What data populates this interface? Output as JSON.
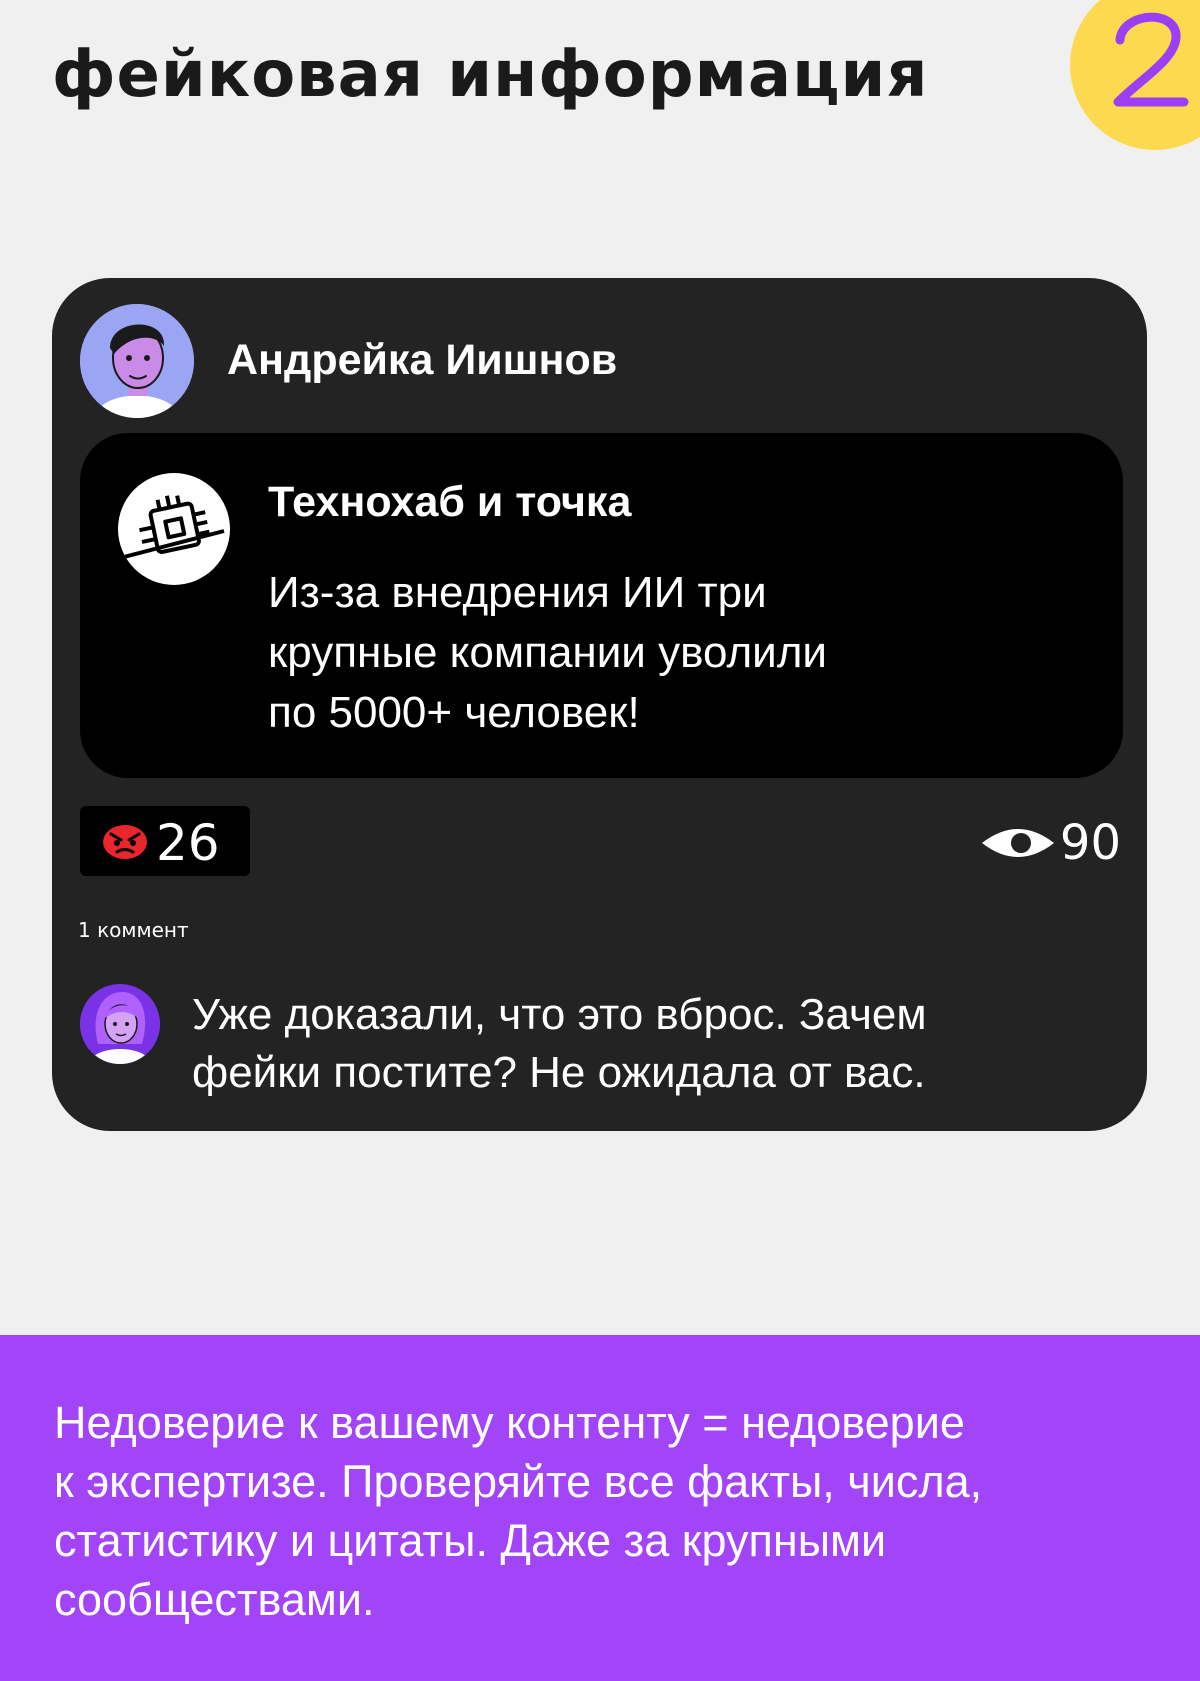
{
  "header": {
    "title": "фейковая информация",
    "page_number": "2"
  },
  "post": {
    "author_name": "Андрейка Иишнов",
    "repost": {
      "channel_name": "Технохаб и точка",
      "text": "Из-за внедрения ИИ три\nкрупные компании уволили\nпо 5000+ человек!"
    },
    "reaction": {
      "icon": "angry-face-icon",
      "count": "26"
    },
    "views": {
      "icon": "eye-icon",
      "count": "90"
    },
    "comments_label": "1 коммент",
    "comment": {
      "text": "Уже доказали, что это вброс. Зачем\nфейки постите? Не ожидала от вас."
    }
  },
  "footer": {
    "text": "Недоверие к вашему контенту = недоверие\nк экспертизе. Проверяйте все факты, числа,\nстатистику и цитаты. Даже за крупными\nсообществами."
  },
  "colors": {
    "background": "#f0f0f0",
    "card": "#232323",
    "repost": "#000000",
    "accent_purple": "#a245f9",
    "badge_yellow": "#fcd94f"
  }
}
